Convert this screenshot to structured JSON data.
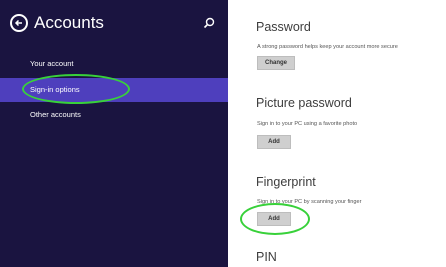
{
  "sidebar": {
    "title": "Accounts",
    "items": [
      {
        "label": "Your account",
        "selected": false
      },
      {
        "label": "Sign-in options",
        "selected": true
      },
      {
        "label": "Other accounts",
        "selected": false
      }
    ],
    "bg_color": "#1a1440",
    "selected_color": "#4e3fbd"
  },
  "main": {
    "password": {
      "title": "Password",
      "desc": "A strong password helps keep your account more secure",
      "button": "Change"
    },
    "picture_password": {
      "title": "Picture password",
      "desc": "Sign in to your PC using a favorite photo",
      "button": "Add"
    },
    "fingerprint": {
      "title": "Fingerprint",
      "desc": "Sign in to your PC by scanning your finger",
      "button": "Add"
    },
    "pin": {
      "title": "PIN"
    }
  },
  "annotations": {
    "highlight_color": "#38d13a"
  },
  "icons": [
    "back-arrow-icon",
    "search-icon"
  ]
}
